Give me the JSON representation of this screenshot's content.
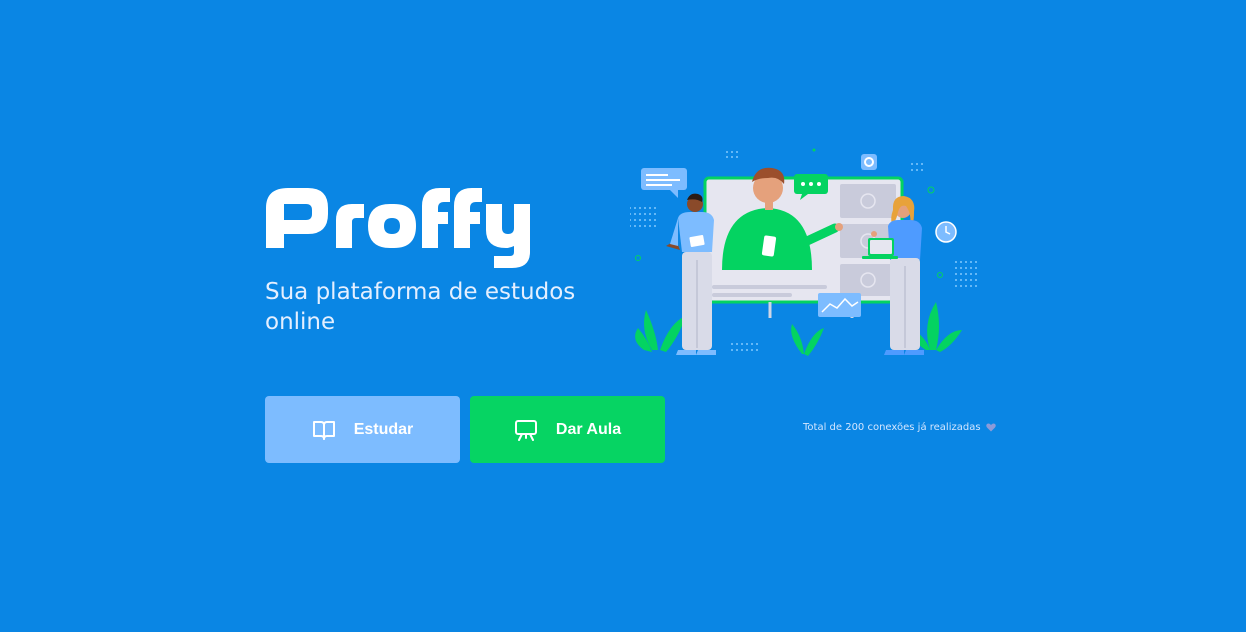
{
  "brand": {
    "name": "Proffy",
    "tagline": "Sua plataforma de estudos online"
  },
  "actions": {
    "study_label": "Estudar",
    "teach_label": "Dar Aula"
  },
  "footer": {
    "connections_text": "Total de 200 conexões já realizadas"
  },
  "colors": {
    "background": "#0a86e4",
    "study_button": "#7dbcff",
    "teach_button": "#06d463",
    "accent_green": "#04d361"
  },
  "icons": {
    "study": "book-open-icon",
    "teach": "presentation-board-icon",
    "connections": "purple-heart-icon"
  }
}
